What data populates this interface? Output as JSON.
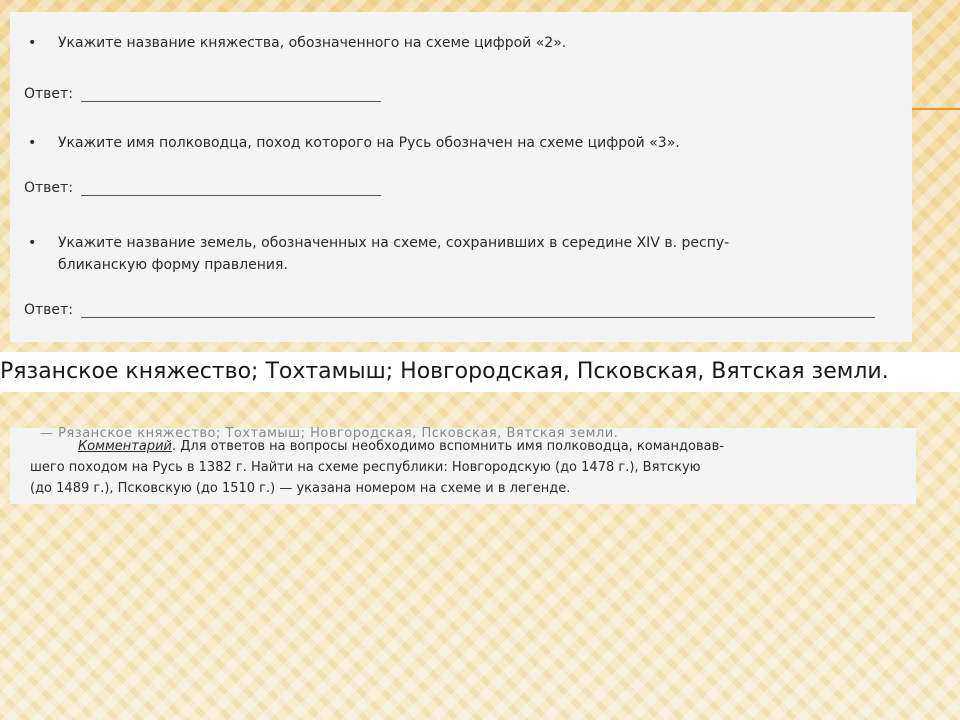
{
  "questions": [
    {
      "bullet": "•",
      "text": "Укажите название княжества, обозначенного на схеме цифрой «2».",
      "answer_label": "Ответ:"
    },
    {
      "bullet": "•",
      "text": "Укажите имя полководца, поход которого на Русь обозначен на схеме цифрой «3».",
      "answer_label": "Ответ:"
    },
    {
      "bullet": "•",
      "text_line1": "Укажите название земель, обозначенных на схеме, сохранивших в середине XIV в. респу-",
      "text_line2": "бликанскую форму правления.",
      "answer_label": "Ответ:"
    }
  ],
  "answer_strip": "Рязанское княжество; Тохтамыш; Новгородская, Псковская, Вятская земли.",
  "comment": {
    "cut_text": "— Рязанское княжество; Тохтамыш; Новгородская, Псковская, Вятская земли.",
    "keyword": "Комментарий",
    "line1_rest": ". Для ответов на вопросы необходимо вспомнить имя полководца, командовав-",
    "line2": "шего походом на Русь в 1382 г. Найти на схеме республики: Новгородскую (до 1478 г.), Вятскую",
    "line3": "(до 1489 г.), Псковскую (до 1510 г.) — указана номером на схеме и в легенде."
  },
  "colors": {
    "accent_line": "#e8952a",
    "scan_bg": "#f4f4f4"
  }
}
